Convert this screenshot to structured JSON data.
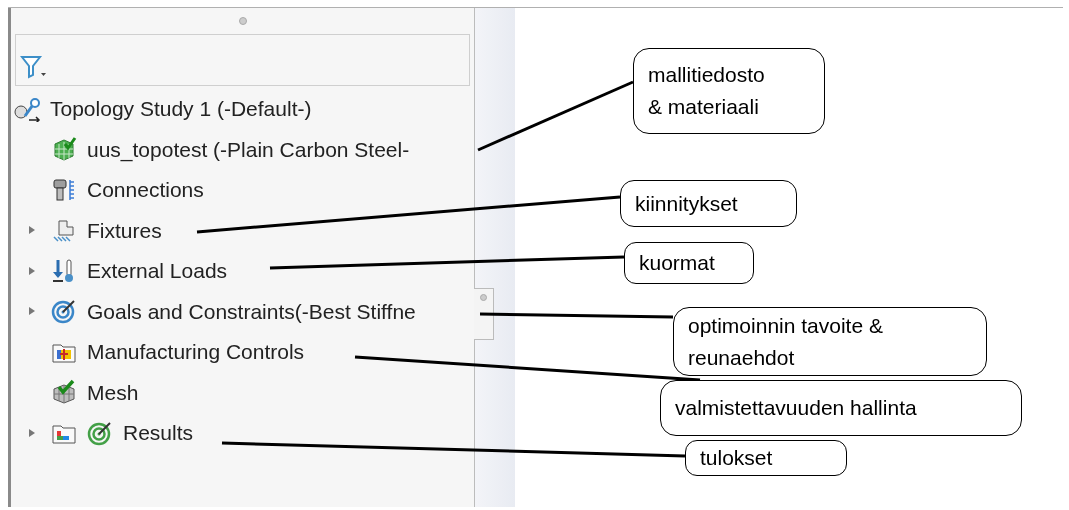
{
  "tree": {
    "label": "Topology Study 1 (-Default-)",
    "children": [
      {
        "label": "uus_topotest (-Plain Carbon Steel-"
      },
      {
        "label": "Connections"
      },
      {
        "label": "Fixtures",
        "expanded": false
      },
      {
        "label": "External Loads",
        "expanded": false
      },
      {
        "label": "Goals and Constraints(-Best Stiffne",
        "expanded": false
      },
      {
        "label": "Manufacturing Controls"
      },
      {
        "label": "Mesh"
      },
      {
        "label": "Results",
        "expanded": false
      }
    ]
  },
  "callouts": [
    {
      "lines": [
        "mallitiedosto",
        "& materiaali"
      ]
    },
    {
      "lines": [
        "kiinnitykset"
      ]
    },
    {
      "lines": [
        "kuormat"
      ]
    },
    {
      "lines": [
        "optimoinnin tavoite &",
        "reunaehdot"
      ]
    },
    {
      "lines": [
        "valmistettavuuden hallinta"
      ]
    },
    {
      "lines": [
        "tulokset"
      ]
    }
  ]
}
